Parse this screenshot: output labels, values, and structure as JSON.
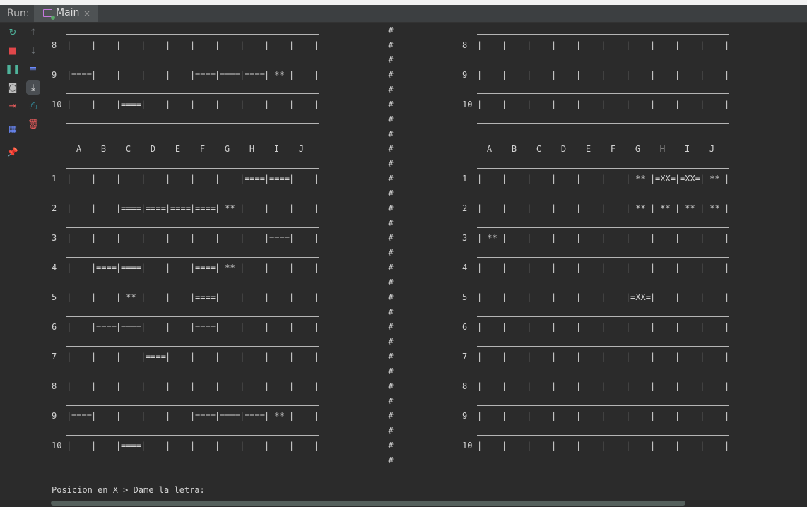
{
  "header": {
    "run_label": "Run:",
    "tab_name": "Main",
    "tab_close": "×"
  },
  "toolbar": {
    "buttons": [
      {
        "name": "rerun-icon",
        "glyph": "↻",
        "color": "#4fb39b",
        "active": true
      },
      {
        "name": "up-arrow-icon",
        "glyph": "↑",
        "color": "#6f7478",
        "active": false
      },
      {
        "name": "stop-icon",
        "glyph": "■",
        "color": "#e0474a",
        "active": true
      },
      {
        "name": "down-arrow-icon",
        "glyph": "↓",
        "color": "#6f7478",
        "active": false
      },
      {
        "name": "pause-icon",
        "glyph": "❚❚",
        "color": "#4fb39b",
        "active": true
      },
      {
        "name": "soft-wrap-icon",
        "glyph": "≡",
        "color": "#6c8cff",
        "active": true
      },
      {
        "name": "camera-icon",
        "glyph": "◙",
        "color": "#bdbdbd",
        "active": true
      },
      {
        "name": "scroll-to-end-icon",
        "glyph": "⤓",
        "color": "#e6e6e6",
        "active": true,
        "selected": true
      },
      {
        "name": "exit-icon",
        "glyph": "⇥",
        "color": "#e05a5a",
        "active": true
      },
      {
        "name": "print-icon",
        "glyph": "⎙",
        "color": "#36a3b8",
        "active": true
      },
      {
        "name": "trash-icon",
        "glyph": "🗑",
        "color": "#e05a5a",
        "active": true
      },
      {
        "name": "layout-icon",
        "glyph": "▦",
        "color": "#6c8cff",
        "active": true
      },
      {
        "name": "pin-icon",
        "glyph": "📌",
        "color": "#c678dd",
        "active": true
      }
    ]
  },
  "console": {
    "columns": [
      "A",
      "B",
      "C",
      "D",
      "E",
      "F",
      "G",
      "H",
      "I",
      "J"
    ],
    "hash": "#",
    "top_left_rows": [
      {
        "label": "8",
        "cells": [
          "",
          "",
          "",
          "",
          "",
          "",
          "",
          "",
          "",
          ""
        ]
      },
      {
        "label": "9",
        "cells": [
          "====",
          "",
          "",
          "",
          "",
          "====",
          "====",
          "====",
          " ** ",
          ""
        ]
      },
      {
        "label": "10",
        "cells": [
          "",
          "",
          "====",
          "",
          "",
          "",
          "",
          "",
          "",
          ""
        ]
      }
    ],
    "top_right_rows": [
      {
        "label": "8",
        "cells": [
          "",
          "",
          "",
          "",
          "",
          "",
          "",
          "",
          "",
          ""
        ]
      },
      {
        "label": "9",
        "cells": [
          "",
          "",
          "",
          "",
          "",
          "",
          "",
          "",
          "",
          ""
        ]
      },
      {
        "label": "10",
        "cells": [
          "",
          "",
          "",
          "",
          "",
          "",
          "",
          "",
          "",
          ""
        ]
      }
    ],
    "left_board": [
      {
        "label": "1",
        "cells": [
          "",
          "",
          "",
          "",
          "",
          "",
          "",
          "====",
          "====",
          ""
        ]
      },
      {
        "label": "2",
        "cells": [
          "",
          "",
          "====",
          "====",
          "====",
          "====",
          " ** ",
          "",
          "",
          ""
        ]
      },
      {
        "label": "3",
        "cells": [
          "",
          "",
          "",
          "",
          "",
          "",
          "",
          "",
          "====",
          ""
        ]
      },
      {
        "label": "4",
        "cells": [
          "",
          "====",
          "====",
          "",
          "",
          "====",
          " ** ",
          "",
          "",
          ""
        ]
      },
      {
        "label": "5",
        "cells": [
          "",
          "",
          " ** ",
          "",
          "",
          "====",
          "",
          "",
          "",
          ""
        ]
      },
      {
        "label": "6",
        "cells": [
          "",
          "====",
          "====",
          "",
          "",
          "====",
          "",
          "",
          "",
          ""
        ]
      },
      {
        "label": "7",
        "cells": [
          "",
          "",
          "",
          "====",
          "",
          "",
          "",
          "",
          "",
          ""
        ]
      },
      {
        "label": "8",
        "cells": [
          "",
          "",
          "",
          "",
          "",
          "",
          "",
          "",
          "",
          ""
        ]
      },
      {
        "label": "9",
        "cells": [
          "====",
          "",
          "",
          "",
          "",
          "====",
          "====",
          "====",
          " ** ",
          ""
        ]
      },
      {
        "label": "10",
        "cells": [
          "",
          "",
          "====",
          "",
          "",
          "",
          "",
          "",
          "",
          ""
        ]
      }
    ],
    "right_board": [
      {
        "label": "1",
        "cells": [
          "",
          "",
          "",
          "",
          "",
          "",
          " ** ",
          "=XX=",
          "=XX=",
          " ** "
        ]
      },
      {
        "label": "2",
        "cells": [
          "",
          "",
          "",
          "",
          "",
          "",
          " ** ",
          " ** ",
          " ** ",
          " ** "
        ]
      },
      {
        "label": "3",
        "cells": [
          " ** ",
          "",
          "",
          "",
          "",
          "",
          "",
          "",
          "",
          ""
        ]
      },
      {
        "label": "4",
        "cells": [
          "",
          "",
          "",
          "",
          "",
          "",
          "",
          "",
          "",
          ""
        ]
      },
      {
        "label": "5",
        "cells": [
          "",
          "",
          "",
          "",
          "",
          "",
          "=XX=",
          "",
          "",
          ""
        ]
      },
      {
        "label": "6",
        "cells": [
          "",
          "",
          "",
          "",
          "",
          "",
          "",
          "",
          "",
          ""
        ]
      },
      {
        "label": "7",
        "cells": [
          "",
          "",
          "",
          "",
          "",
          "",
          "",
          "",
          "",
          ""
        ]
      },
      {
        "label": "8",
        "cells": [
          "",
          "",
          "",
          "",
          "",
          "",
          "",
          "",
          "",
          ""
        ]
      },
      {
        "label": "9",
        "cells": [
          "",
          "",
          "",
          "",
          "",
          "",
          "",
          "",
          "",
          ""
        ]
      },
      {
        "label": "10",
        "cells": [
          "",
          "",
          "",
          "",
          "",
          "",
          "",
          "",
          "",
          ""
        ]
      }
    ],
    "prompt": "Posicion en X > Dame la letra:"
  }
}
